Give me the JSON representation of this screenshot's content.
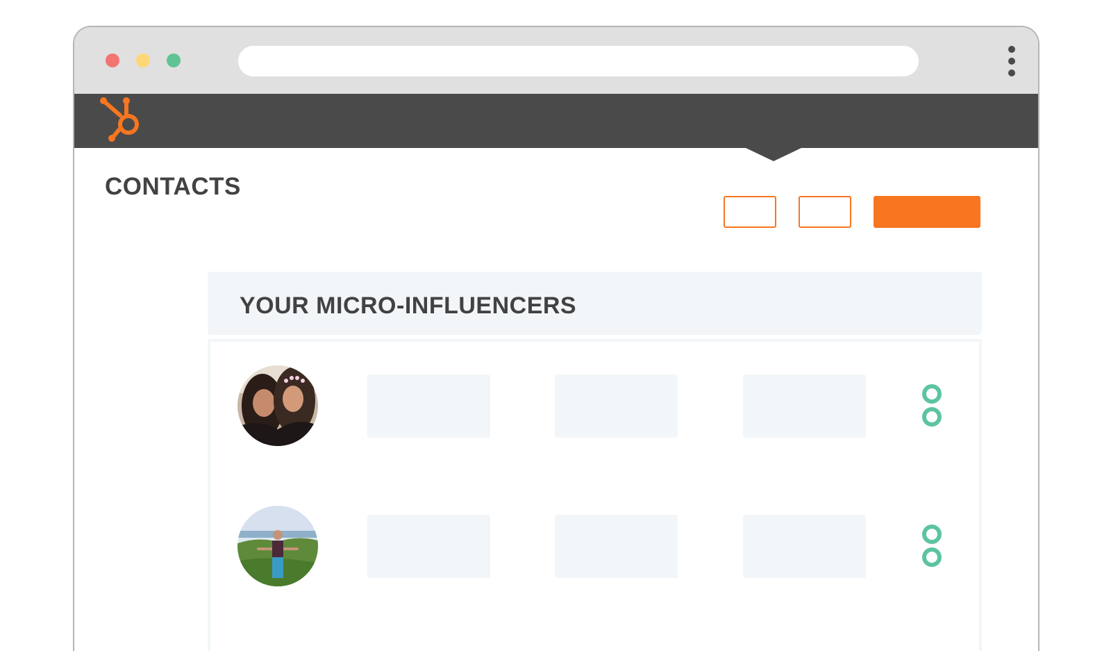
{
  "colors": {
    "accent": "#f7761f",
    "dark_bar": "#4a4a4a",
    "chrome": "#e0e0e0",
    "panel": "#f2f6f9",
    "grin_green": "#5dc3a3"
  },
  "header": {
    "logo_icon": "hubspot-sprocket-icon"
  },
  "page": {
    "title": "CONTACTS"
  },
  "toolbar": {
    "buttons": [
      "",
      "",
      ""
    ]
  },
  "card": {
    "title": "YOUR MICRO-INFLUENCERS",
    "rows": [
      {
        "avatar": "two-women-selfie-photo",
        "cells": [
          "",
          "",
          ""
        ],
        "icon": "grin-logo-icon"
      },
      {
        "avatar": "man-outdoors-photo",
        "cells": [
          "",
          "",
          ""
        ],
        "icon": "grin-logo-icon"
      }
    ]
  }
}
